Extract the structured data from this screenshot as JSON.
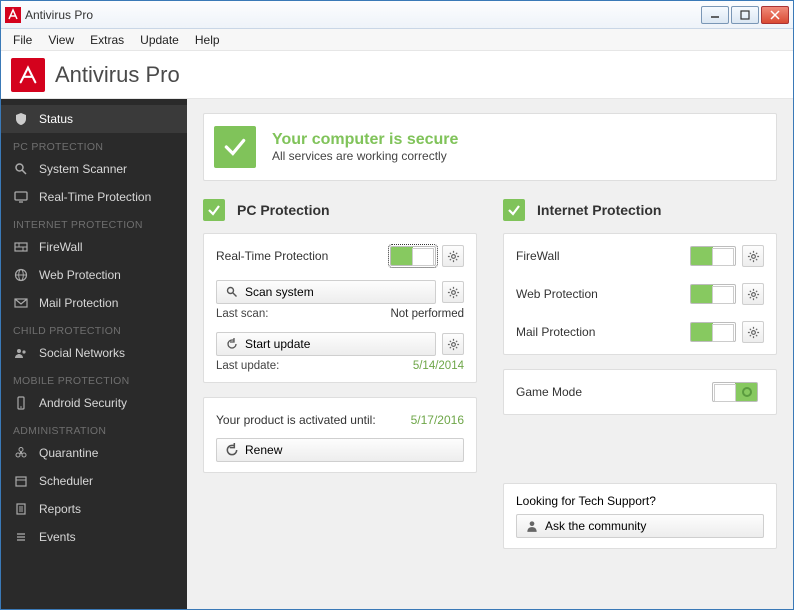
{
  "window": {
    "title": "Antivirus Pro"
  },
  "menu": {
    "file": "File",
    "view": "View",
    "extras": "Extras",
    "update": "Update",
    "help": "Help"
  },
  "brand": {
    "name": "Antivirus Pro"
  },
  "sidebar": {
    "status": "Status",
    "sec_pc": "PC PROTECTION",
    "system_scanner": "System Scanner",
    "realtime": "Real-Time Protection",
    "sec_net": "INTERNET PROTECTION",
    "firewall": "FireWall",
    "webprot": "Web Protection",
    "mailprot": "Mail Protection",
    "sec_child": "CHILD PROTECTION",
    "social": "Social Networks",
    "sec_mobile": "MOBILE PROTECTION",
    "android": "Android Security",
    "sec_admin": "ADMINISTRATION",
    "quarantine": "Quarantine",
    "scheduler": "Scheduler",
    "reports": "Reports",
    "events": "Events"
  },
  "status": {
    "headline": "Your computer is secure",
    "sub": "All services are working correctly"
  },
  "pc": {
    "title": "PC Protection",
    "realtime_label": "Real-Time Protection",
    "scan_btn": "Scan system",
    "last_scan_label": "Last scan:",
    "last_scan_value": "Not performed",
    "update_btn": "Start update",
    "last_update_label": "Last update:",
    "last_update_value": "5/14/2014",
    "activated_label": "Your product is activated until:",
    "activated_value": "5/17/2016",
    "renew_btn": "Renew"
  },
  "net": {
    "title": "Internet Protection",
    "firewall": "FireWall",
    "web": "Web Protection",
    "mail": "Mail Protection",
    "game": "Game Mode"
  },
  "support": {
    "q": "Looking for Tech Support?",
    "btn": "Ask the community"
  }
}
